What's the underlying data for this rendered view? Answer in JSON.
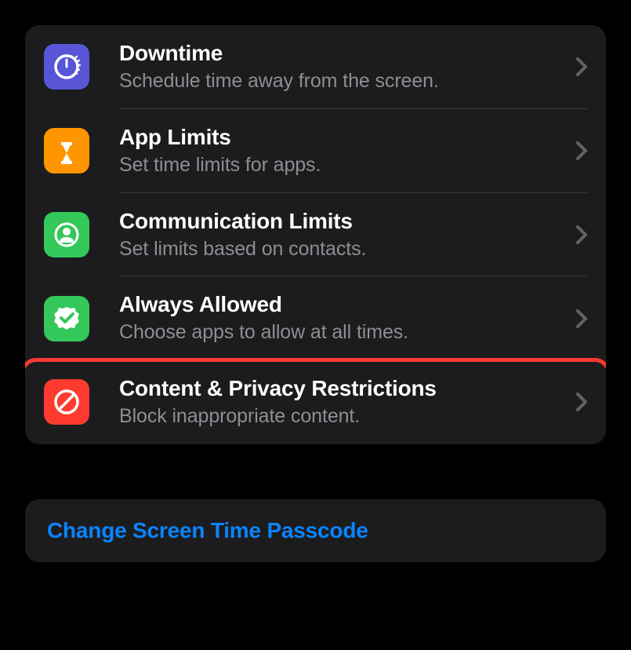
{
  "items": [
    {
      "title": "Downtime",
      "subtitle": "Schedule time away from the screen.",
      "iconName": "downtime-icon",
      "iconColor": "purple"
    },
    {
      "title": "App Limits",
      "subtitle": "Set time limits for apps.",
      "iconName": "app-limits-icon",
      "iconColor": "orange"
    },
    {
      "title": "Communication Limits",
      "subtitle": "Set limits based on contacts.",
      "iconName": "communication-limits-icon",
      "iconColor": "green"
    },
    {
      "title": "Always Allowed",
      "subtitle": "Choose apps to allow at all times.",
      "iconName": "always-allowed-icon",
      "iconColor": "green"
    },
    {
      "title": "Content & Privacy Restrictions",
      "subtitle": "Block inappropriate content.",
      "iconName": "content-privacy-icon",
      "iconColor": "red",
      "highlighted": true
    }
  ],
  "button": {
    "label": "Change Screen Time Passcode"
  },
  "colors": {
    "purple": "#5856d6",
    "orange": "#ff9500",
    "green": "#34c759",
    "red": "#ff3b30",
    "link": "#0a84ff"
  }
}
